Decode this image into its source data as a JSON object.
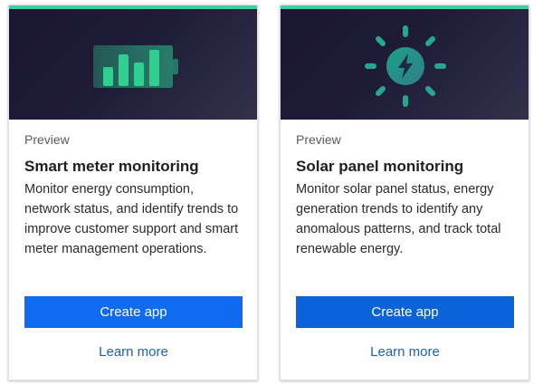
{
  "cards": [
    {
      "preview": "Preview",
      "title": "Smart meter monitoring",
      "description": "Monitor energy consumption, network status, and identify trends to improve customer support and smart meter management operations.",
      "button_label": "Create app",
      "link_label": "Learn more",
      "icon": "battery-chart-icon"
    },
    {
      "preview": "Preview",
      "title": "Solar panel monitoring",
      "description": "Monitor solar panel status, energy generation trends to identify any anomalous patterns, and track total renewable energy.",
      "button_label": "Create app",
      "link_label": "Learn more",
      "icon": "sun-bolt-icon"
    }
  ],
  "colors": {
    "accent": "#3ad29f",
    "hero_bg": "#1e1b36",
    "button": "#0f6cf2",
    "link": "#1f5fb3"
  }
}
